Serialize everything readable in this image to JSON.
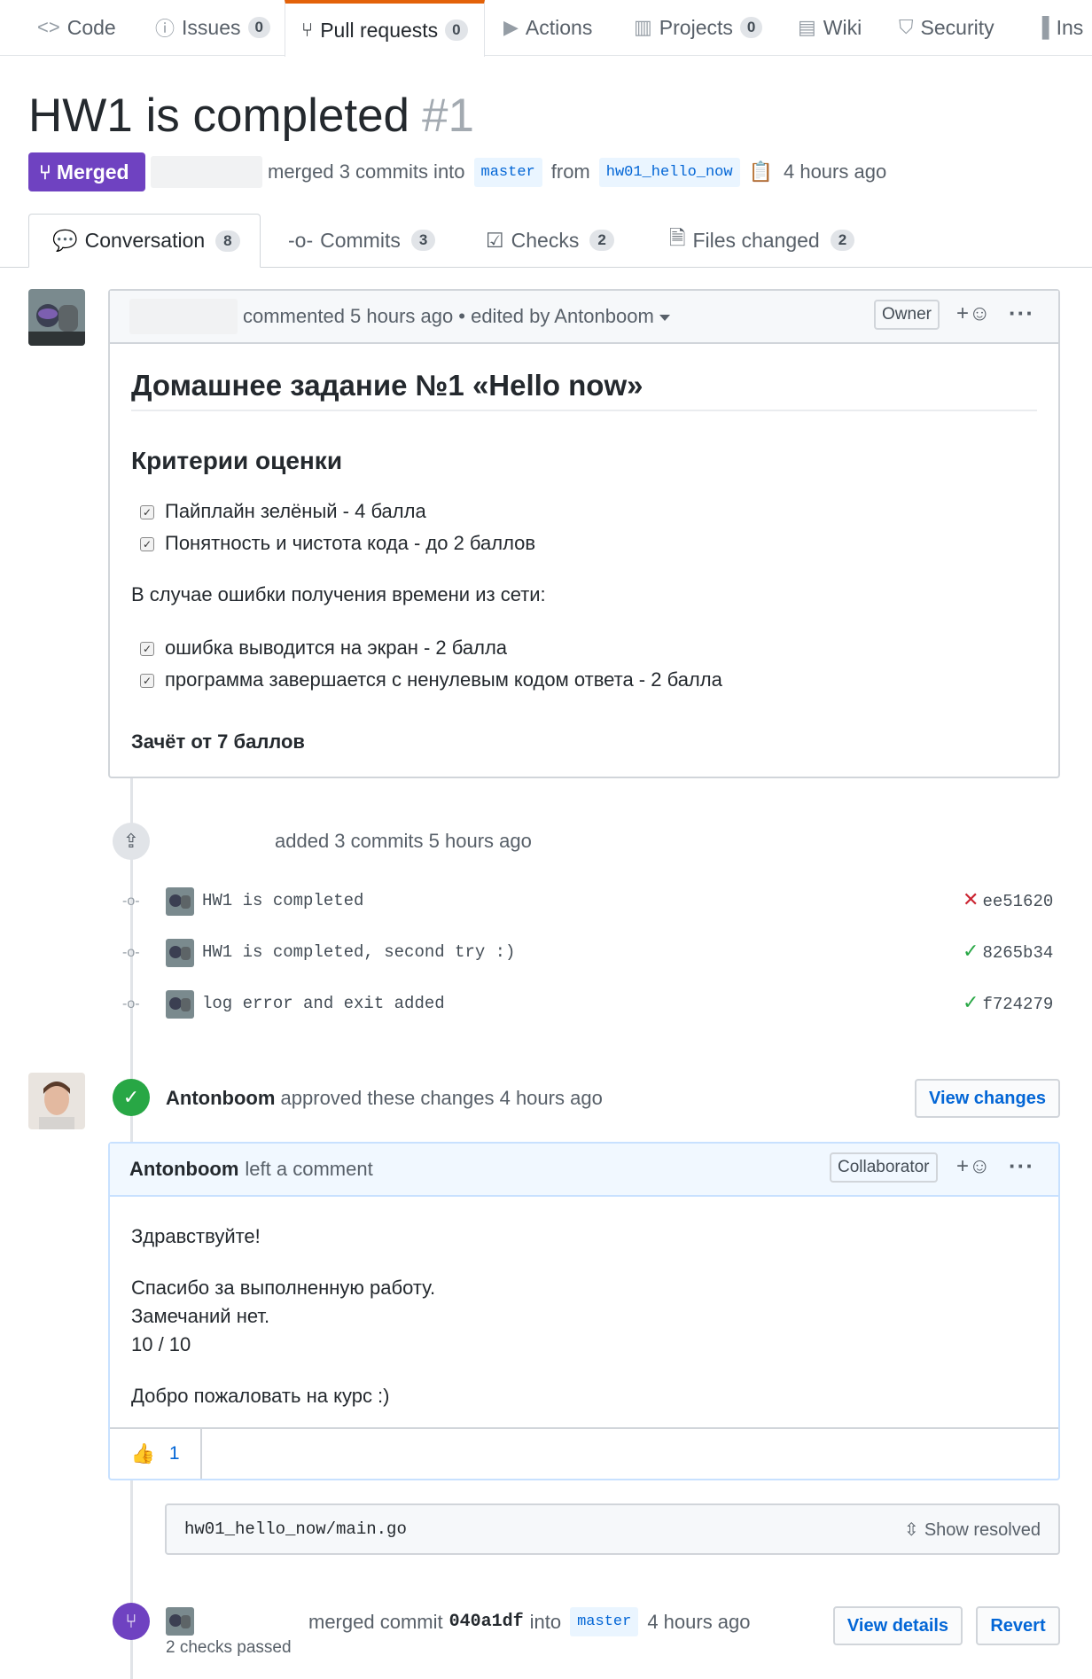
{
  "repo_nav": {
    "tabs": [
      {
        "label": "Code",
        "icon": "code-icon"
      },
      {
        "label": "Issues",
        "icon": "issue-icon",
        "count": "0"
      },
      {
        "label": "Pull requests",
        "icon": "pull-request-icon",
        "count": "0",
        "active": true
      },
      {
        "label": "Actions",
        "icon": "play-icon"
      },
      {
        "label": "Projects",
        "icon": "project-icon",
        "count": "0"
      },
      {
        "label": "Wiki",
        "icon": "book-icon"
      },
      {
        "label": "Security",
        "icon": "shield-icon"
      },
      {
        "label": "Ins",
        "icon": "graph-icon"
      }
    ]
  },
  "pr": {
    "title": "HW1 is completed",
    "number": "#1",
    "state": "Merged",
    "meta_merged": "merged 3 commits into",
    "base_branch": "master",
    "meta_from": "from",
    "head_branch": "hw01_hello_now",
    "time": "4 hours ago"
  },
  "pr_tabs": [
    {
      "label": "Conversation",
      "count": "8",
      "icon": "comment-discussion-icon"
    },
    {
      "label": "Commits",
      "count": "3",
      "icon": "git-commit-icon"
    },
    {
      "label": "Checks",
      "count": "2",
      "icon": "checklist-icon"
    },
    {
      "label": "Files changed",
      "count": "2",
      "icon": "file-diff-icon"
    }
  ],
  "opening_comment": {
    "header_text": "commented 5 hours ago",
    "edited_text": "• edited by Antonboom",
    "role": "Owner",
    "h1": "Домашнее задание №1 «Hello now»",
    "h2": "Критерии оценки",
    "tasks_1": [
      "Пайплайн зелёный - 4 балла",
      "Понятность и чистота кода - до 2 баллов"
    ],
    "paragraph": "В случае ошибки получения времени из сети:",
    "tasks_2": [
      "ошибка выводится на экран - 2 балла",
      "программа завершается с ненулевым кодом ответа - 2 балла"
    ],
    "footer_bold": "Зачёт от 7 баллов"
  },
  "commits_event": {
    "text": "added 3 commits 5 hours ago",
    "commits": [
      {
        "message": "HW1 is completed",
        "sha": "ee51620",
        "status": "failure"
      },
      {
        "message": "HW1 is completed, second try :)",
        "sha": "8265b34",
        "status": "success"
      },
      {
        "message": "log error and exit added",
        "sha": "f724279",
        "status": "success"
      }
    ]
  },
  "review": {
    "author": "Antonboom",
    "action": "approved these changes 4 hours ago",
    "view_changes": "View changes",
    "comment_author": "Antonboom",
    "comment_action": "left a comment",
    "role": "Collaborator",
    "lines": [
      "Здравствуйте!",
      "Спасибо за выполненную работу.",
      "Замечаний нет.",
      "10 / 10",
      "Добро пожаловать на курс :)"
    ],
    "reaction_emoji": "👍",
    "reaction_count": "1"
  },
  "file_box": {
    "path": "hw01_hello_now/main.go",
    "show_resolved": "Show resolved"
  },
  "merge_event": {
    "prefix": "merged commit",
    "sha": "040a1df",
    "into": "into",
    "branch": "master",
    "time": "4 hours ago",
    "checks": "2 checks passed",
    "view_details": "View details",
    "revert": "Revert"
  },
  "colors": {
    "merged_purple": "#6f42c1",
    "success_green": "#28a745",
    "failure_red": "#cb2431",
    "link_blue": "#0366d6",
    "active_tab_orange": "#e36209"
  }
}
